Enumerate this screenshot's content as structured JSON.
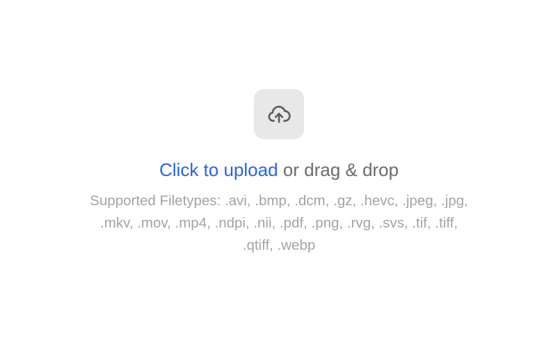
{
  "upload": {
    "icon": "cloud-upload-icon",
    "link_text": "Click to upload",
    "rest_text": " or drag & drop",
    "filetypes_text": "Supported Filetypes: .avi, .bmp, .dcm, .gz, .hevc, .jpeg, .jpg, .mkv, .mov, .mp4, .ndpi, .nii, .pdf, .png, .rvg, .svs, .tif, .tiff, .qtiff, .webp"
  },
  "colors": {
    "link": "#2563eb",
    "headline": "#6b6b6b",
    "subtext": "#a3a3a3",
    "icon_bg": "#e8e8e8",
    "icon_stroke": "#5f5f5f"
  }
}
